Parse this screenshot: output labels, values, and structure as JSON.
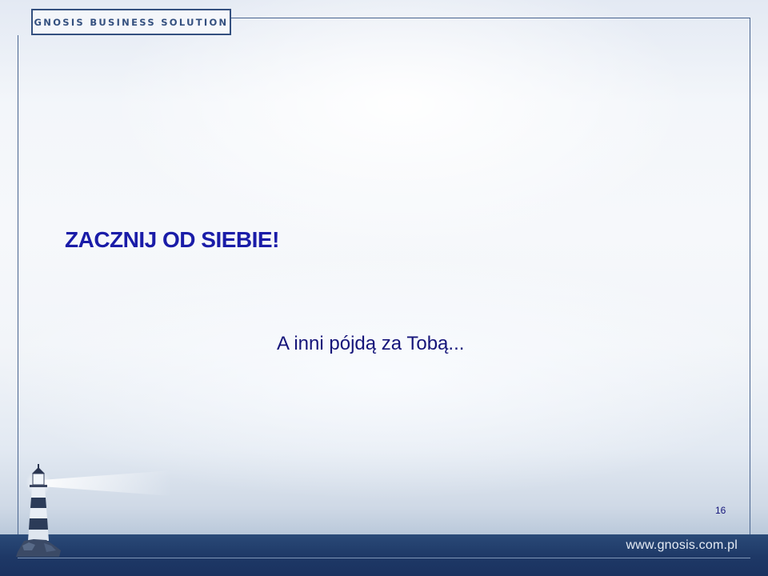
{
  "header": {
    "logo_text": "GNOSIS BUSINESS SOLUTION"
  },
  "slide": {
    "title": "ZACZNIJ OD SIEBIE!",
    "subtitle": "A inni pójdą za Tobą...",
    "page_number": "16"
  },
  "footer": {
    "website": "www.gnosis.com.pl"
  },
  "colors": {
    "title": "#1a1ca8",
    "text": "#15157a",
    "brand": "#34507f",
    "band": "#1e3866"
  },
  "icons": {
    "lighthouse": "lighthouse-icon"
  }
}
